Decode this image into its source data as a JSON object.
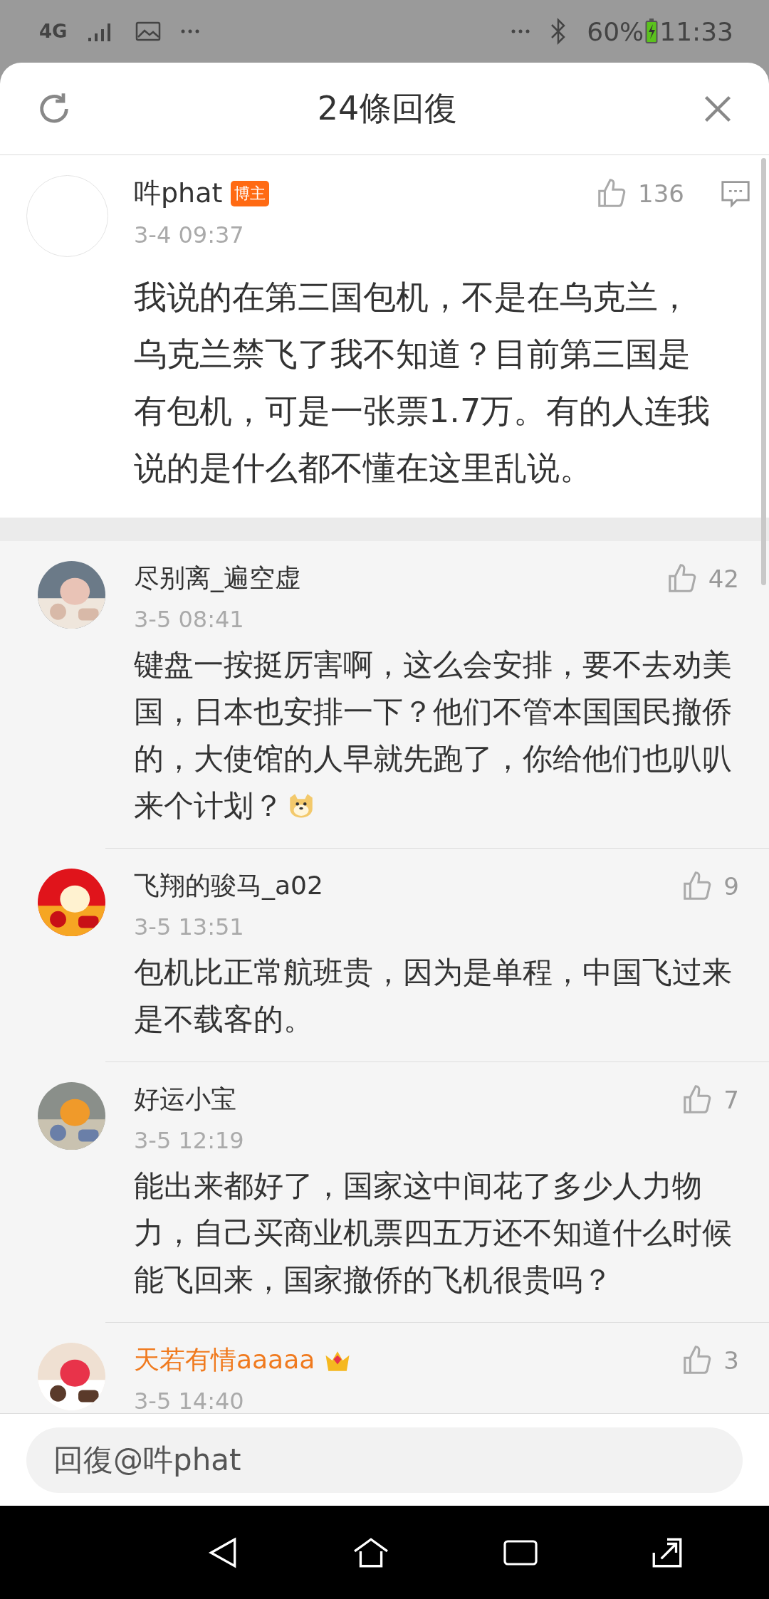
{
  "status_bar": {
    "network": "4G",
    "battery": "60%",
    "time": "11:33"
  },
  "header": {
    "title": "24條回復"
  },
  "post": {
    "author": "吽phat",
    "badge": "博主",
    "likes": "136",
    "time": "3-4 09:37",
    "text": "我说的在第三国包机，不是在乌克兰，乌克兰禁飞了我不知道？目前第三国是有包机，可是一张票1.7万。有的人连我说的是什么都不懂在这里乱说。"
  },
  "replies": [
    {
      "author": "尽别离_遍空虚",
      "vip": false,
      "likes": "42",
      "time": "3-5 08:41",
      "text": "键盘一按挺厉害啊，这么会安排，要不去劝美国，日本也安排一下？他们不管本国国民撤侨的，大使馆的人早就先跑了，你给他们也叭叭来个计划？",
      "emoji": true
    },
    {
      "author": "飞翔的骏马_a02",
      "vip": false,
      "likes": "9",
      "time": "3-5 13:51",
      "text": "包机比正常航班贵，因为是单程，中国飞过来是不载客的。",
      "emoji": false
    },
    {
      "author": "好运小宝",
      "vip": false,
      "likes": "7",
      "time": "3-5 12:19",
      "text": "能出来都好了，国家这中间花了多少人力物力，自己买商业机票四五万还不知道什么时候能飞回来，国家撤侨的飞机很贵吗？",
      "emoji": false
    },
    {
      "author": "天若有情aaaaa",
      "vip": true,
      "likes": "3",
      "time": "3-5 14:40"
    }
  ],
  "reply_box": {
    "placeholder": "回復@吽phat"
  }
}
